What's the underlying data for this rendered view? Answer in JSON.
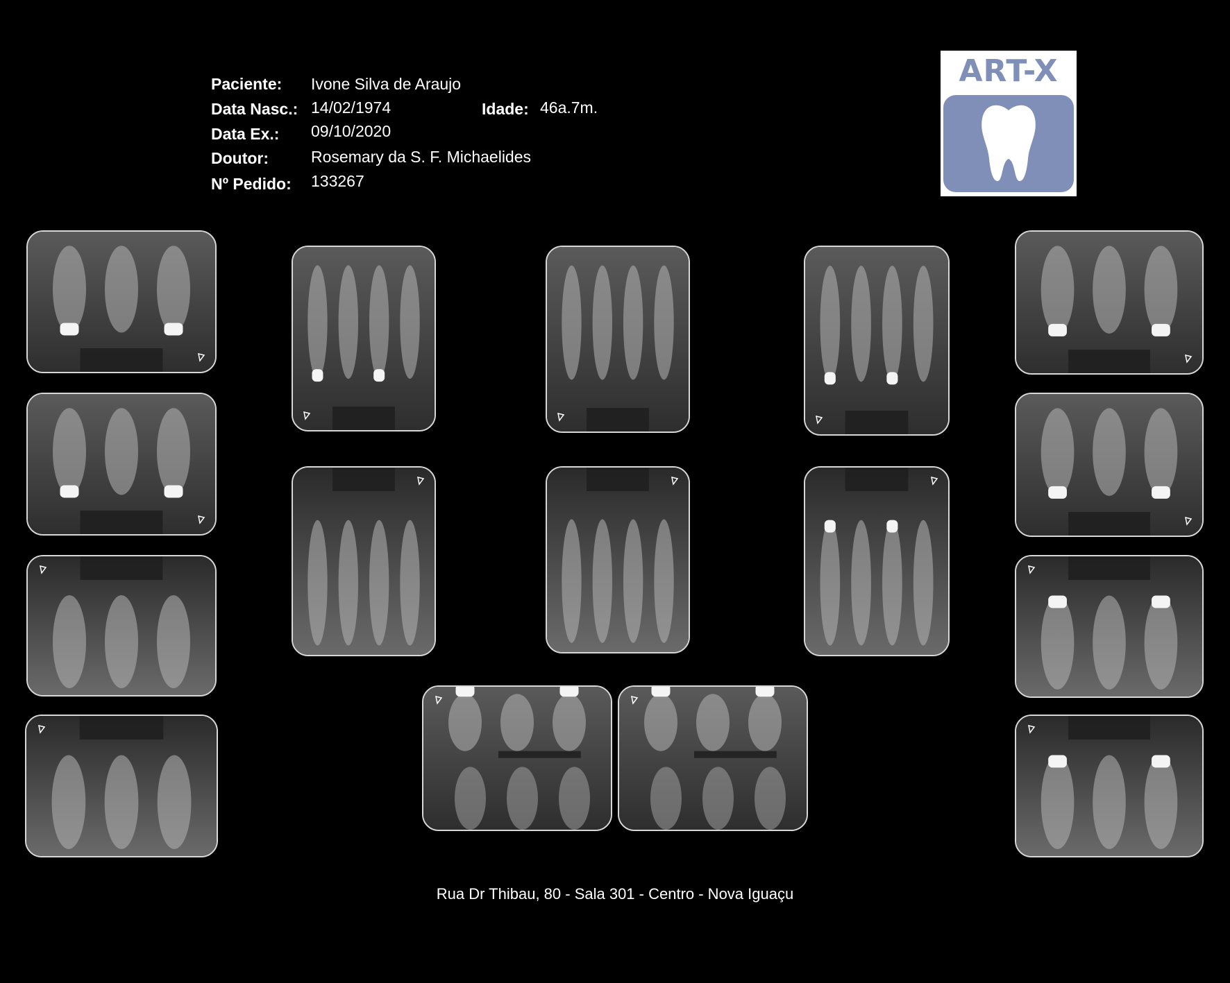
{
  "patient": {
    "name_label": "Paciente:",
    "name": "Ivone Silva de Araujo",
    "birth_label": "Data Nasc.:",
    "birth": "14/02/1974",
    "age_label": "Idade:",
    "age": "46a.7m.",
    "exam_label": "Data Ex.:",
    "exam": "09/10/2020",
    "doctor_label": "Doutor:",
    "doctor": "Rosemary da S. F. Michaelides",
    "order_label": "Nº Pedido:",
    "order": "133267"
  },
  "logo": {
    "text": "ART-X",
    "icon": "tooth-icon",
    "color": "#7f8fb8"
  },
  "radiographs": [
    {
      "arch": "upper",
      "orient": "h",
      "marker": "bottom-right",
      "fill": 1
    },
    {
      "arch": "upper",
      "orient": "h",
      "marker": "bottom-right",
      "fill": 1
    },
    {
      "arch": "lower",
      "orient": "h",
      "marker": "top-left",
      "fill": 0
    },
    {
      "arch": "lower",
      "orient": "h",
      "marker": "top-left",
      "fill": 0
    },
    {
      "arch": "upper",
      "orient": "v",
      "marker": "bottom-left",
      "fill": 1
    },
    {
      "arch": "lower",
      "orient": "v",
      "marker": "top-right",
      "fill": 0
    },
    {
      "arch": "upper",
      "orient": "v",
      "marker": "bottom-left",
      "fill": 0
    },
    {
      "arch": "lower",
      "orient": "v",
      "marker": "top-right",
      "fill": 0
    },
    {
      "arch": "upper",
      "orient": "v",
      "marker": "bottom-left",
      "fill": 1
    },
    {
      "arch": "lower",
      "orient": "v",
      "marker": "top-right",
      "fill": 1
    },
    {
      "arch": "upper",
      "orient": "h",
      "marker": "bottom-right",
      "fill": 1
    },
    {
      "arch": "upper",
      "orient": "h",
      "marker": "bottom-right",
      "fill": 1
    },
    {
      "arch": "lower",
      "orient": "h",
      "marker": "top-left",
      "fill": 1
    },
    {
      "arch": "lower",
      "orient": "h",
      "marker": "top-left",
      "fill": 1
    },
    {
      "arch": "bitewing",
      "orient": "h",
      "marker": "top-left",
      "fill": 1
    },
    {
      "arch": "bitewing",
      "orient": "h",
      "marker": "top-left",
      "fill": 1
    }
  ],
  "footer": {
    "address": "Rua Dr Thibau, 80 - Sala 301 - Centro - Nova Iguaçu"
  }
}
